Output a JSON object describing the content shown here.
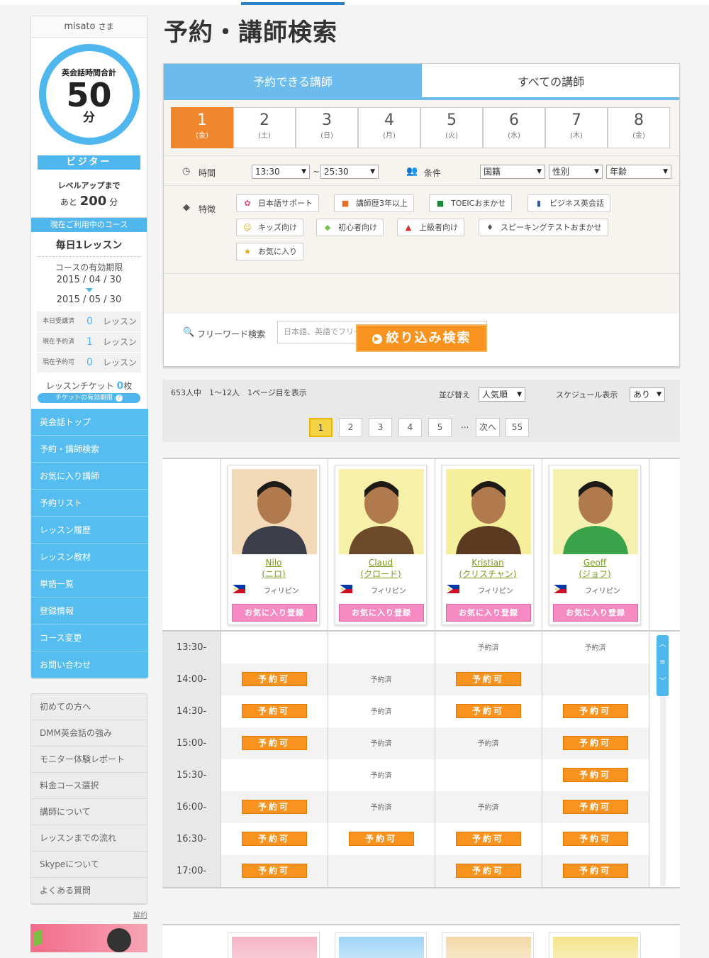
{
  "title": "予約・講師検索",
  "user": {
    "name": "misato",
    "honorific": "さま",
    "total_label": "英会話時間合計",
    "total_value": "50",
    "total_unit": "分",
    "rank": "ビジター",
    "levelup_label": "レベルアップまで",
    "levelup_prefix": "あと",
    "levelup_value": "200",
    "levelup_unit": "分"
  },
  "course": {
    "header": "現在ご利用中のコース",
    "name": "毎日1レッスン",
    "valid_label": "コースの有効期限",
    "start": "2015 / 04 / 30",
    "end": "2015 / 05 / 30",
    "counts": [
      {
        "label": "本日受講済",
        "value": "0",
        "unit": "レッスン"
      },
      {
        "label": "現在予約済",
        "value": "1",
        "unit": "レッスン"
      },
      {
        "label": "現在予約可",
        "value": "0",
        "unit": "レッスン"
      }
    ],
    "ticket_label": "レッスンチケット",
    "ticket_value": "0",
    "ticket_unit": "枚",
    "ticket_link": "チケットの有効期限",
    "ticket_q": "?"
  },
  "nav": [
    "英会話トップ",
    "予約・講師検索",
    "お気に入り講師",
    "予約リスト",
    "レッスン履歴",
    "レッスン教材",
    "単語一覧",
    "登録情報",
    "コース変更",
    "お問い合わせ"
  ],
  "nav2": [
    "初めての方へ",
    "DMM英会話の強み",
    "モニター体験レポート",
    "料金コース選択",
    "講師について",
    "レッスンまでの流れ",
    "Skypeについて",
    "よくある質問"
  ],
  "cancel": "解約",
  "tabs": [
    "予約できる講師",
    "すべての講師"
  ],
  "days": [
    {
      "n": "1",
      "w": "(金)"
    },
    {
      "n": "2",
      "w": "(土)"
    },
    {
      "n": "3",
      "w": "(日)"
    },
    {
      "n": "4",
      "w": "(月)"
    },
    {
      "n": "5",
      "w": "(火)"
    },
    {
      "n": "6",
      "w": "(水)"
    },
    {
      "n": "7",
      "w": "(木)"
    },
    {
      "n": "8",
      "w": "(金)"
    }
  ],
  "filters": {
    "time_label": "時間",
    "time_from": "13:30",
    "tilde": "~",
    "time_to": "25:30",
    "cond_label": "条件",
    "nationality": "国籍",
    "gender": "性別",
    "age": "年齢",
    "feature_label": "特徴",
    "freeword_label": "フリーワード検索",
    "freeword_placeholder": "日本語、英語でフリーワード検索ができます",
    "search_button": "絞り込み検索"
  },
  "tags": [
    {
      "label": "日本語サポート",
      "icon": "✿",
      "color": "#e0457b"
    },
    {
      "label": "講師歴3年以上",
      "icon": "■",
      "color": "#e8702a"
    },
    {
      "label": "TOEICおまかせ",
      "icon": "■",
      "color": "#1a8a3a"
    },
    {
      "label": "ビジネス英会話",
      "icon": "▮",
      "color": "#2e5aa8"
    },
    {
      "label": "キッズ向け",
      "icon": "☺",
      "color": "#e8a300"
    },
    {
      "label": "初心者向け",
      "icon": "◆",
      "color": "#7bc043"
    },
    {
      "label": "上級者向け",
      "icon": "▲",
      "color": "#d32f2f"
    },
    {
      "label": "スピーキングテストおまかせ",
      "icon": "♦",
      "color": "#555"
    },
    {
      "label": "お気に入り",
      "icon": "★",
      "color": "#e8a300"
    }
  ],
  "results": {
    "summary": "653人中　1〜12人　1ページ目を表示",
    "sort_label": "並び替え",
    "sort_value": "人気順",
    "sched_label": "スケジュール表示",
    "sched_value": "あり",
    "pages": [
      "1",
      "2",
      "3",
      "4",
      "5",
      "...",
      "次へ",
      "55"
    ]
  },
  "teachers": [
    {
      "name": "Nilo",
      "kana": "(ニロ)",
      "country": "フィリピン",
      "fav": "お気に入り登録"
    },
    {
      "name": "Claud",
      "kana": "(クロード)",
      "country": "フィリピン",
      "fav": "お気に入り登録"
    },
    {
      "name": "Kristian",
      "kana": "(クリスチャン)",
      "country": "フィリピン",
      "fav": "お気に入り登録"
    },
    {
      "name": "Geoff",
      "kana": "(ジョフ)",
      "country": "フィリピン",
      "fav": "お気に入り登録"
    }
  ],
  "slots": [
    "13:30-",
    "14:00-",
    "14:30-",
    "15:00-",
    "15:30-",
    "16:00-",
    "16:30-",
    "17:00-"
  ],
  "status_labels": {
    "open": "予約可",
    "booked": "予約済"
  },
  "schedule": [
    [
      "",
      "",
      "booked",
      "booked"
    ],
    [
      "open",
      "booked",
      "open",
      ""
    ],
    [
      "open",
      "booked",
      "open",
      "open"
    ],
    [
      "open",
      "booked",
      "booked",
      "open"
    ],
    [
      "",
      "booked",
      "",
      "open"
    ],
    [
      "open",
      "booked",
      "booked",
      "open"
    ],
    [
      "open",
      "open",
      "open",
      "open"
    ],
    [
      "open",
      "",
      "open",
      "open"
    ]
  ]
}
